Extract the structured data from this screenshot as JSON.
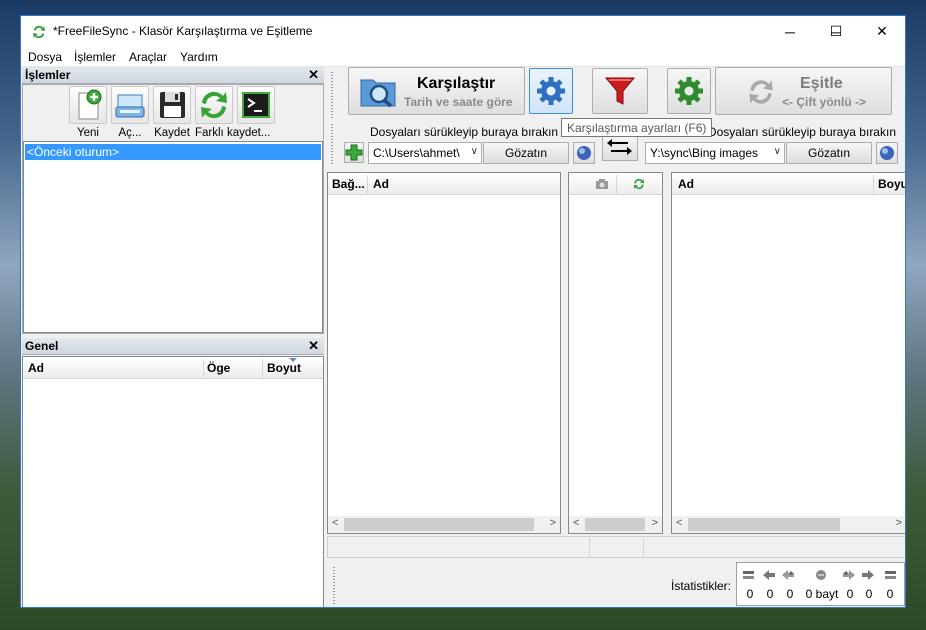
{
  "window": {
    "title": "*FreeFileSync - Klasör Karşılaştırma ve Eşitleme",
    "minimize_glyph": "─",
    "maximize_glyph": "☐",
    "close_glyph": "✕"
  },
  "menu": [
    "Dosya",
    "İşlemler",
    "Araçlar",
    "Yardım"
  ],
  "operations_panel": {
    "title": "İşlemler",
    "close": "✕",
    "tools": [
      {
        "label": "Yeni",
        "icon": "new-config-icon"
      },
      {
        "label": "Aç...",
        "icon": "open-config-icon"
      },
      {
        "label": "Kaydet",
        "icon": "save-icon"
      },
      {
        "label": "Farklı kaydet...",
        "icon": "save-as-batch-icon"
      },
      {
        "label": "",
        "icon": "batch-job-icon"
      }
    ],
    "session_item": "<Önceki oturum>"
  },
  "overview_panel": {
    "title": "Genel",
    "close": "✕",
    "columns": [
      "Ad",
      "Öge",
      "Boyut"
    ]
  },
  "compare": {
    "title": "Karşılaştır",
    "subtitle": "Tarih ve saate göre",
    "tooltip": "Karşılaştırma ayarları (F6)"
  },
  "sync": {
    "title": "Eşitle",
    "subtitle": "<- Çift yönlü ->"
  },
  "left_folder": {
    "drop_hint": "Dosyaları sürükleyip buraya bırakın",
    "path": "C:\\Users\\ahmet\\",
    "browse": "Gözatın"
  },
  "right_folder": {
    "drop_hint": "Dosyaları sürükleyip buraya bırakın",
    "path": "Y:\\sync\\Bing images",
    "browse": "Gözatın"
  },
  "left_grid": {
    "columns": [
      "Bağ...",
      "Ad"
    ]
  },
  "right_grid": {
    "columns": [
      "Ad",
      "Boyut"
    ]
  },
  "statistics": {
    "label": "İstatistikler:",
    "values": [
      "0",
      "0",
      "0",
      "0 bayt",
      "0",
      "0",
      "0"
    ]
  },
  "colors": {
    "accent": "#2b79c9",
    "selection": "#3399ff",
    "filter_red": "#cc1b1b",
    "gear_blue": "#2f6fbf",
    "gear_green": "#2e8b2e"
  }
}
